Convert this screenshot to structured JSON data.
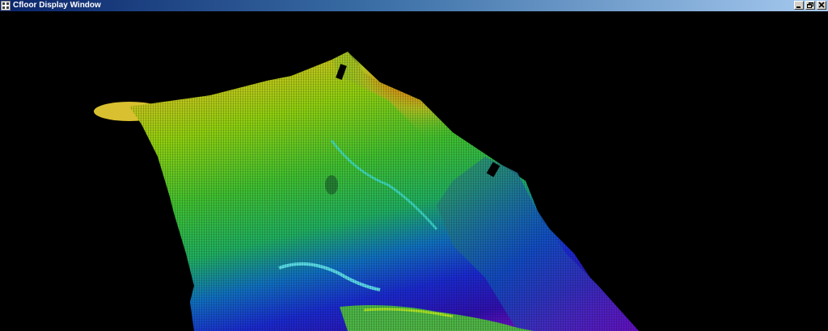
{
  "window": {
    "title": "Cfloor Display Window"
  },
  "icons": {
    "app": "app-icon",
    "minimize": "minimize-icon",
    "restore": "restore-icon",
    "close": "close-icon"
  },
  "colors": {
    "background": "#000000",
    "titlebar_start": "#0a246a",
    "titlebar_end": "#a6caf0",
    "colormap": [
      "#ff2a10",
      "#ffd700",
      "#a0e000",
      "#30c040",
      "#00e0d0",
      "#0040ff",
      "#3000a0",
      "#8000c0"
    ]
  }
}
